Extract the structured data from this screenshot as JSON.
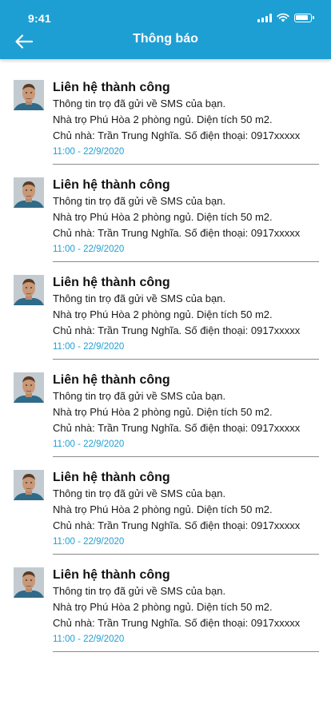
{
  "status_bar": {
    "time": "9:41"
  },
  "header": {
    "title": "Thông báo",
    "back_icon": "arrow-left-icon",
    "background": "#1e9fd3"
  },
  "notifications": [
    {
      "title": "Liên hệ thành công",
      "line1": "Thông tin trọ đã gửi về SMS của bạn.",
      "line2": "Nhà trọ Phú Hòa 2 phòng ngủ. Diện tích 50 m2.",
      "line3": "Chủ nhà: Trần Trung Nghĩa. Số điện thoại: 0917xxxxx",
      "time": "11:00 - 22/9/2020"
    },
    {
      "title": "Liên hệ thành công",
      "line1": "Thông tin trọ đã gửi về SMS của bạn.",
      "line2": "Nhà trọ Phú Hòa 2 phòng ngủ. Diện tích 50 m2.",
      "line3": "Chủ nhà: Trần Trung Nghĩa. Số điện thoại: 0917xxxxx",
      "time": "11:00 - 22/9/2020"
    },
    {
      "title": "Liên hệ thành công",
      "line1": "Thông tin trọ đã gửi về SMS của bạn.",
      "line2": "Nhà trọ Phú Hòa 2 phòng ngủ. Diện tích 50 m2.",
      "line3": "Chủ nhà: Trần Trung Nghĩa. Số điện thoại: 0917xxxxx",
      "time": "11:00 - 22/9/2020"
    },
    {
      "title": "Liên hệ thành công",
      "line1": "Thông tin trọ đã gửi về SMS của bạn.",
      "line2": "Nhà trọ Phú Hòa 2 phòng ngủ. Diện tích 50 m2.",
      "line3": "Chủ nhà: Trần Trung Nghĩa. Số điện thoại: 0917xxxxx",
      "time": "11:00 - 22/9/2020"
    },
    {
      "title": "Liên hệ thành công",
      "line1": "Thông tin trọ đã gửi về SMS của bạn.",
      "line2": "Nhà trọ Phú Hòa 2 phòng ngủ. Diện tích 50 m2.",
      "line3": "Chủ nhà: Trần Trung Nghĩa. Số điện thoại: 0917xxxxx",
      "time": "11:00 - 22/9/2020"
    },
    {
      "title": "Liên hệ thành công",
      "line1": "Thông tin trọ đã gửi về SMS của bạn.",
      "line2": "Nhà trọ Phú Hòa 2 phòng ngủ. Diện tích 50 m2.",
      "line3": "Chủ nhà: Trần Trung Nghĩa. Số điện thoại: 0917xxxxx",
      "time": "11:00 - 22/9/2020"
    }
  ]
}
